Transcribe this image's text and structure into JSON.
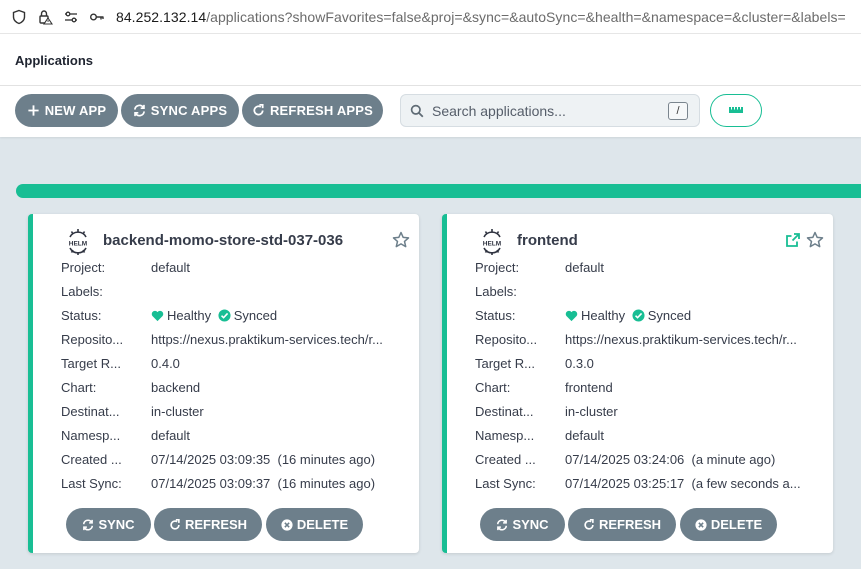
{
  "browser": {
    "url_host": "84.252.132.14",
    "url_path": "/applications?showFavorites=false&proj=&sync=&autoSync=&health=&namespace=&cluster=&labels="
  },
  "header": {
    "title": "Applications"
  },
  "toolbar": {
    "new_app": "NEW APP",
    "sync_apps": "SYNC APPS",
    "refresh_apps": "REFRESH APPS",
    "search_placeholder": "Search applications...",
    "search_shortcut": "/"
  },
  "colors": {
    "healthy": "#18be94",
    "button": "#6d7f8b"
  },
  "apps": [
    {
      "name": "backend-momo-store-std-037-036",
      "labels": {
        "project": "Project:",
        "labels": "Labels:",
        "status": "Status:",
        "repository": "Reposito...",
        "target": "Target R...",
        "chart": "Chart:",
        "destination": "Destinat...",
        "namespace": "Namesp...",
        "created": "Created ...",
        "last_sync": "Last Sync:"
      },
      "project": "default",
      "labels_value": "",
      "health": "Healthy",
      "sync": "Synced",
      "repository": "https://nexus.praktikum-services.tech/r...",
      "target_revision": "0.4.0",
      "chart": "backend",
      "destination": "in-cluster",
      "namespace": "default",
      "created": "07/14/2025 03:09:35  (16 minutes ago)",
      "last_sync": "07/14/2025 03:09:37  (16 minutes ago)",
      "actions": {
        "sync": "SYNC",
        "refresh": "REFRESH",
        "delete": "DELETE"
      }
    },
    {
      "name": "frontend",
      "labels": {
        "project": "Project:",
        "labels": "Labels:",
        "status": "Status:",
        "repository": "Reposito...",
        "target": "Target R...",
        "chart": "Chart:",
        "destination": "Destinat...",
        "namespace": "Namesp...",
        "created": "Created ...",
        "last_sync": "Last Sync:"
      },
      "project": "default",
      "labels_value": "",
      "health": "Healthy",
      "sync": "Synced",
      "repository": "https://nexus.praktikum-services.tech/r...",
      "target_revision": "0.3.0",
      "chart": "frontend",
      "destination": "in-cluster",
      "namespace": "default",
      "created": "07/14/2025 03:24:06  (a minute ago)",
      "last_sync": "07/14/2025 03:25:17  (a few seconds a...",
      "actions": {
        "sync": "SYNC",
        "refresh": "REFRESH",
        "delete": "DELETE"
      }
    }
  ]
}
